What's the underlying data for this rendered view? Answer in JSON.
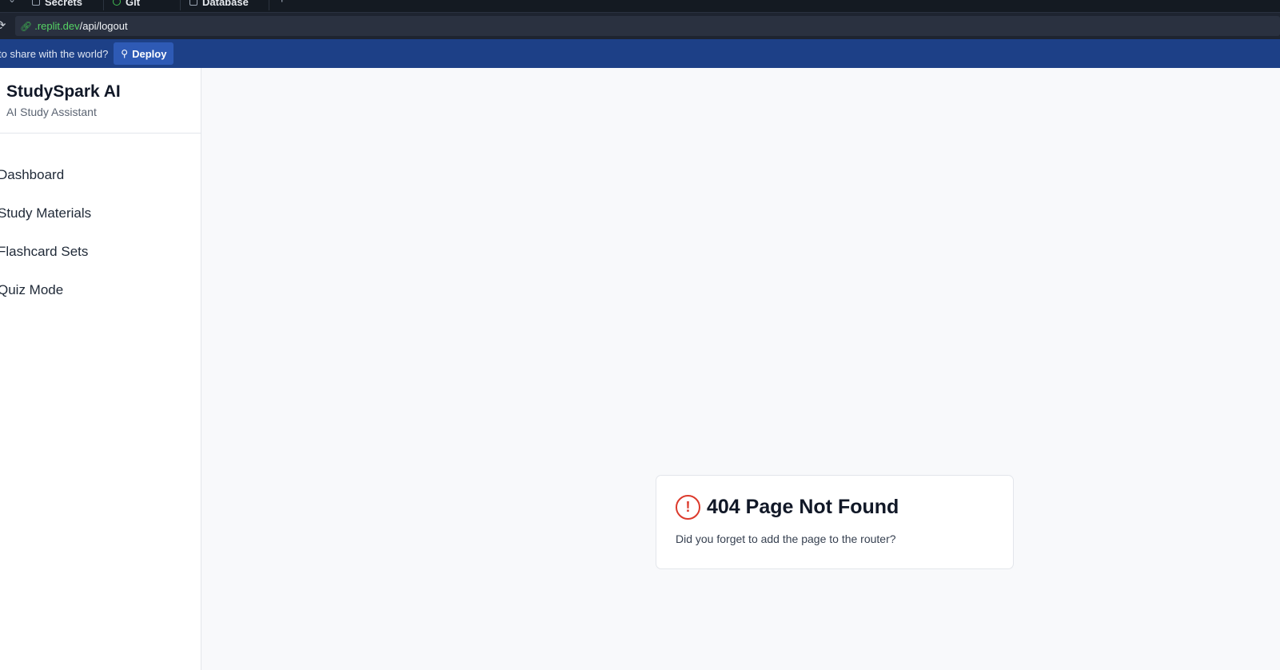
{
  "browser": {
    "tabs": [
      {
        "label": "Secrets",
        "icon": "lock-icon"
      },
      {
        "label": "Git",
        "icon": "git-icon"
      },
      {
        "label": "Database",
        "icon": "database-icon"
      }
    ],
    "new_tab_label": "+",
    "url": {
      "host": ".replit.dev",
      "path": "/api/logout"
    }
  },
  "banner": {
    "message": "to share with the world?",
    "deploy_label": "Deploy"
  },
  "sidebar": {
    "app_name": "StudySpark AI",
    "app_tagline": "AI Study Assistant",
    "items": [
      {
        "label": "Dashboard"
      },
      {
        "label": "Study Materials"
      },
      {
        "label": "Flashcard Sets"
      },
      {
        "label": "Quiz Mode"
      }
    ]
  },
  "error": {
    "title": "404 Page Not Found",
    "description": "Did you forget to add the page to the router?",
    "icon": "alert-circle-icon",
    "icon_color": "#dc3a2c"
  },
  "colors": {
    "banner_bg": "#1d4087",
    "deploy_button": "#2e5ab5",
    "url_host": "#56d364"
  }
}
